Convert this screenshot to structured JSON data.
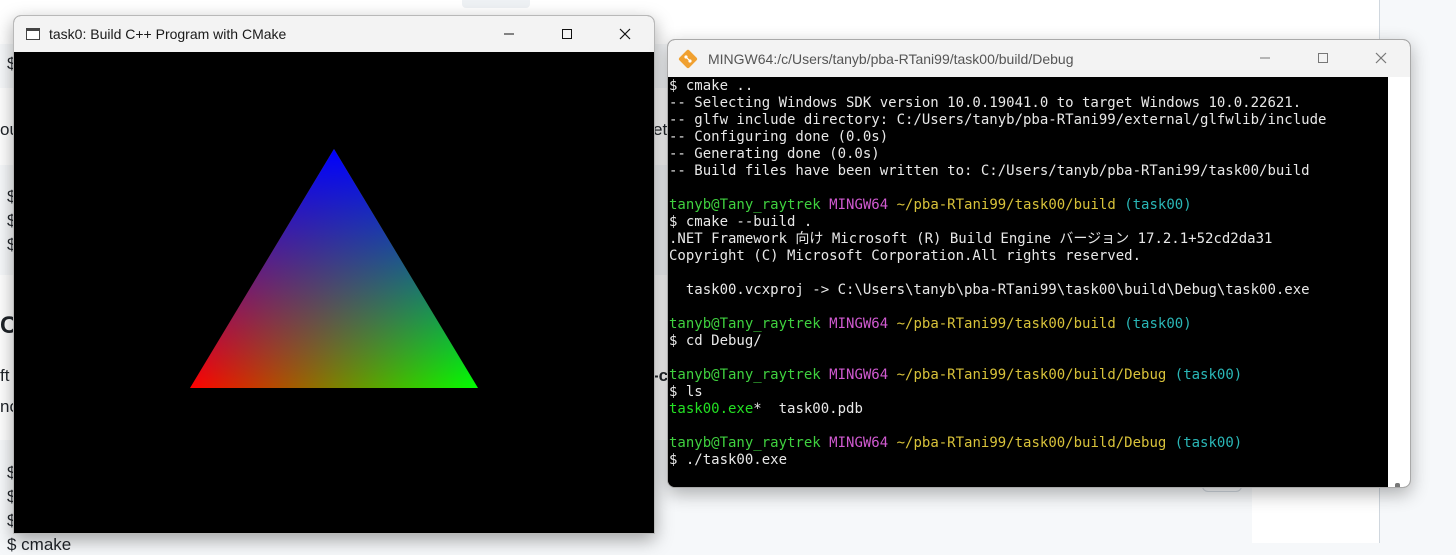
{
  "background_page": {
    "fragments": [
      "$",
      "ou",
      "$",
      "$",
      "$",
      "Co",
      "ft",
      "no",
      "$",
      "$",
      "$",
      "$ cmake",
      "et",
      "-c"
    ]
  },
  "gl_window": {
    "title": "task0: Build C++ Program with CMake",
    "triangle_colors": {
      "top": "#0000ff",
      "left": "#ff0000",
      "right": "#00ff00"
    }
  },
  "terminal": {
    "title": "MINGW64:/c/Users/tanyb/pba-RTani99/task00/build/Debug",
    "lines": [
      {
        "segs": [
          {
            "t": "$ cmake ..",
            "c": ""
          }
        ]
      },
      {
        "segs": [
          {
            "t": "-- Selecting Windows SDK version 10.0.19041.0 to target Windows 10.0.22621.",
            "c": ""
          }
        ]
      },
      {
        "segs": [
          {
            "t": "-- glfw include directory: C:/Users/tanyb/pba-RTani99/external/glfwlib/include",
            "c": ""
          }
        ]
      },
      {
        "segs": [
          {
            "t": "-- Configuring done (0.0s)",
            "c": ""
          }
        ]
      },
      {
        "segs": [
          {
            "t": "-- Generating done (0.0s)",
            "c": ""
          }
        ]
      },
      {
        "segs": [
          {
            "t": "-- Build files have been written to: C:/Users/tanyb/pba-RTani99/task00/build",
            "c": ""
          }
        ]
      },
      {
        "segs": [
          {
            "t": "",
            "c": ""
          }
        ]
      },
      {
        "segs": [
          {
            "t": "tanyb@Tany_raytrek",
            "c": "c-green"
          },
          {
            "t": " ",
            "c": ""
          },
          {
            "t": "MINGW64",
            "c": "c-mag"
          },
          {
            "t": " ",
            "c": ""
          },
          {
            "t": "~/pba-RTani99/task00/build",
            "c": "c-yel"
          },
          {
            "t": " ",
            "c": ""
          },
          {
            "t": "(task00)",
            "c": "c-cyan"
          }
        ]
      },
      {
        "segs": [
          {
            "t": "$ cmake --build .",
            "c": ""
          }
        ]
      },
      {
        "segs": [
          {
            "t": ".NET Framework 向け Microsoft (R) Build Engine バージョン 17.2.1+52cd2da31",
            "c": ""
          }
        ]
      },
      {
        "segs": [
          {
            "t": "Copyright (C) Microsoft Corporation.All rights reserved.",
            "c": ""
          }
        ]
      },
      {
        "segs": [
          {
            "t": "",
            "c": ""
          }
        ]
      },
      {
        "segs": [
          {
            "t": "  task00.vcxproj -> C:\\Users\\tanyb\\pba-RTani99\\task00\\build\\Debug\\task00.exe",
            "c": ""
          }
        ]
      },
      {
        "segs": [
          {
            "t": "",
            "c": ""
          }
        ]
      },
      {
        "segs": [
          {
            "t": "tanyb@Tany_raytrek",
            "c": "c-green"
          },
          {
            "t": " ",
            "c": ""
          },
          {
            "t": "MINGW64",
            "c": "c-mag"
          },
          {
            "t": " ",
            "c": ""
          },
          {
            "t": "~/pba-RTani99/task00/build",
            "c": "c-yel"
          },
          {
            "t": " ",
            "c": ""
          },
          {
            "t": "(task00)",
            "c": "c-cyan"
          }
        ]
      },
      {
        "segs": [
          {
            "t": "$ cd Debug/",
            "c": ""
          }
        ]
      },
      {
        "segs": [
          {
            "t": "",
            "c": ""
          }
        ]
      },
      {
        "segs": [
          {
            "t": "tanyb@Tany_raytrek",
            "c": "c-green"
          },
          {
            "t": " ",
            "c": ""
          },
          {
            "t": "MINGW64",
            "c": "c-mag"
          },
          {
            "t": " ",
            "c": ""
          },
          {
            "t": "~/pba-RTani99/task00/build/Debug",
            "c": "c-yel"
          },
          {
            "t": " ",
            "c": ""
          },
          {
            "t": "(task00)",
            "c": "c-cyan"
          }
        ]
      },
      {
        "segs": [
          {
            "t": "$ ls",
            "c": ""
          }
        ]
      },
      {
        "segs": [
          {
            "t": "task00.exe",
            "c": "c-exe"
          },
          {
            "t": "*  task00.pdb",
            "c": ""
          }
        ]
      },
      {
        "segs": [
          {
            "t": "",
            "c": ""
          }
        ]
      },
      {
        "segs": [
          {
            "t": "tanyb@Tany_raytrek",
            "c": "c-green"
          },
          {
            "t": " ",
            "c": ""
          },
          {
            "t": "MINGW64",
            "c": "c-mag"
          },
          {
            "t": " ",
            "c": ""
          },
          {
            "t": "~/pba-RTani99/task00/build/Debug",
            "c": "c-yel"
          },
          {
            "t": " ",
            "c": ""
          },
          {
            "t": "(task00)",
            "c": "c-cyan"
          }
        ]
      },
      {
        "segs": [
          {
            "t": "$ ./task00.exe",
            "c": ""
          }
        ]
      }
    ]
  },
  "icons": {
    "gl_app": "window-icon",
    "terminal_app": "git-bash-icon",
    "minimize": "minimize-icon",
    "maximize": "maximize-icon",
    "close": "close-icon"
  }
}
